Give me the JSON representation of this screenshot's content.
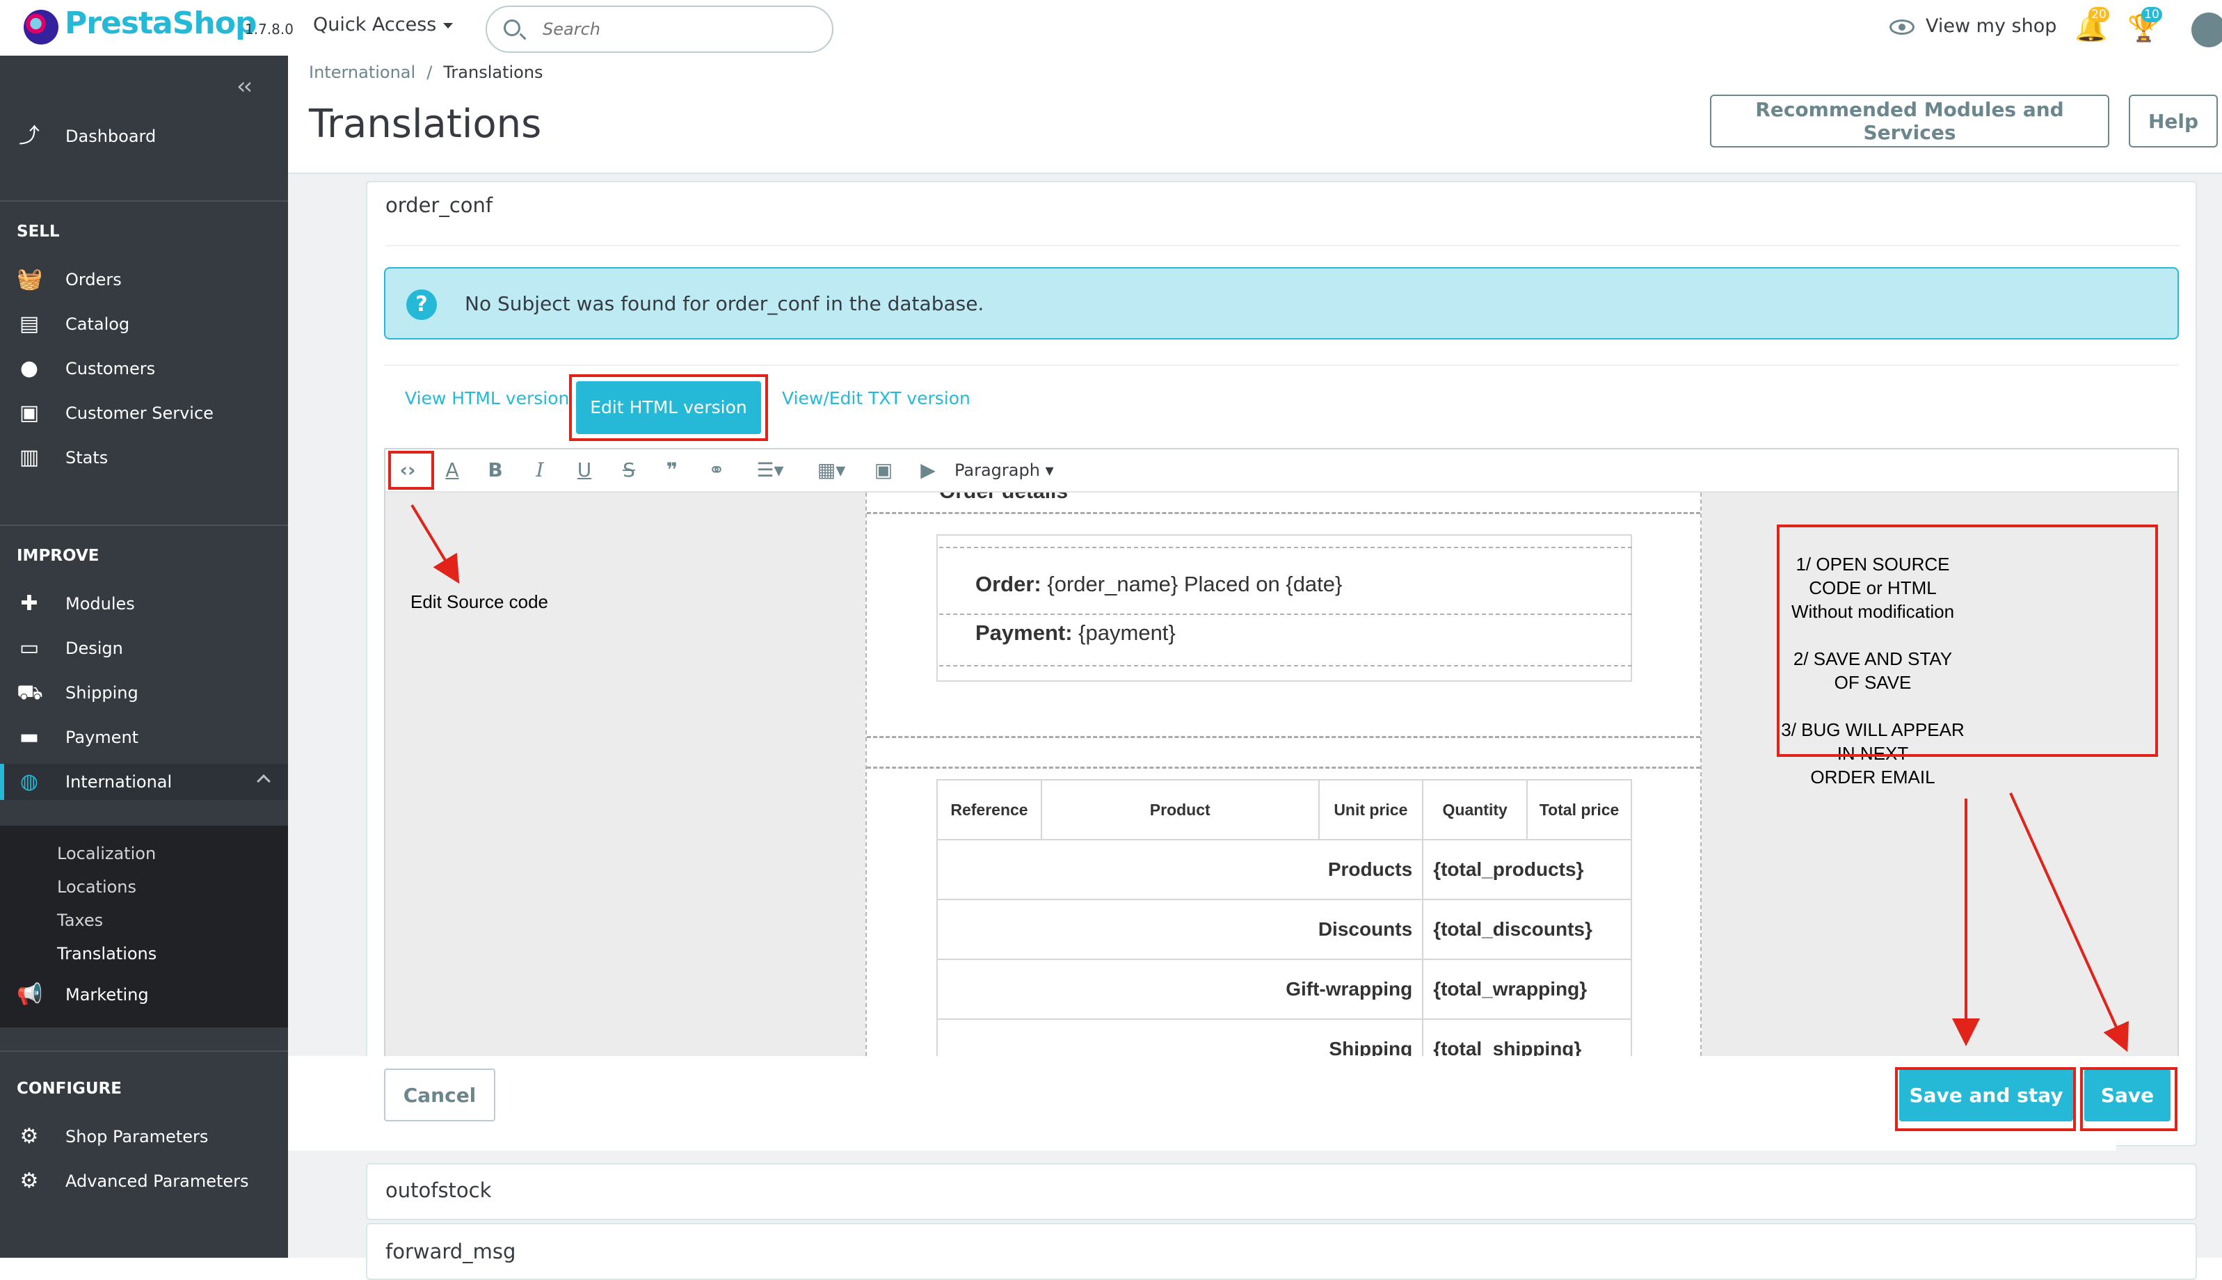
{
  "app": {
    "brand": "PrestaShop",
    "version": "1.7.8.0",
    "quick_access": "Quick Access",
    "search_placeholder": "Search",
    "view_shop": "View my shop",
    "notif_badge_1": "20",
    "notif_badge_2": "10",
    "colors": {
      "accent": "#25b9d7",
      "sidebar": "#363a41",
      "annotation": "#e2231a"
    }
  },
  "sidebar": {
    "dashboard": "Dashboard",
    "sections": {
      "sell": "SELL",
      "improve": "IMPROVE",
      "configure": "CONFIGURE"
    },
    "sell_items": [
      "Orders",
      "Catalog",
      "Customers",
      "Customer Service",
      "Stats"
    ],
    "improve_items": [
      "Modules",
      "Design",
      "Shipping",
      "Payment",
      "International"
    ],
    "international_sub": [
      "Localization",
      "Locations",
      "Taxes",
      "Translations"
    ],
    "marketing": "Marketing",
    "configure_items": [
      "Shop Parameters",
      "Advanced Parameters"
    ]
  },
  "header": {
    "breadcrumb": [
      "International",
      "Translations"
    ],
    "title": "Translations",
    "recommended": "Recommended Modules and Services",
    "help": "Help"
  },
  "main": {
    "template_name": "order_conf",
    "alert": "No Subject was found for order_conf in the database.",
    "tabs": [
      "View HTML version",
      "Edit HTML version",
      "View/Edit TXT version"
    ],
    "format_select": "Paragraph",
    "doc": {
      "partial_heading": "Order details",
      "order_label": "Order:",
      "order_value": "{order_name} Placed on {date}",
      "payment_label": "Payment:",
      "payment_value": "{payment}",
      "table_headers": [
        "Reference",
        "Product",
        "Unit price",
        "Quantity",
        "Total price"
      ],
      "summary_rows": [
        {
          "label": "Products",
          "value": "{total_products}"
        },
        {
          "label": "Discounts",
          "value": "{total_discounts}"
        },
        {
          "label": "Gift-wrapping",
          "value": "{total_wrapping}"
        },
        {
          "label": "Shipping",
          "value": "{total_shipping}"
        }
      ]
    },
    "cancel": "Cancel",
    "save_and_stay": "Save and stay",
    "save": "Save",
    "next_templates": [
      "outofstock",
      "forward_msg"
    ]
  },
  "annotations": {
    "edit_source": "Edit Source code",
    "steps": [
      "1/ OPEN SOURCE CODE or HTML",
      "Without modification",
      "2/ SAVE AND STAY OF SAVE",
      "3/ BUG WILL APPEAR IN NEXT",
      "ORDER EMAIL"
    ]
  }
}
